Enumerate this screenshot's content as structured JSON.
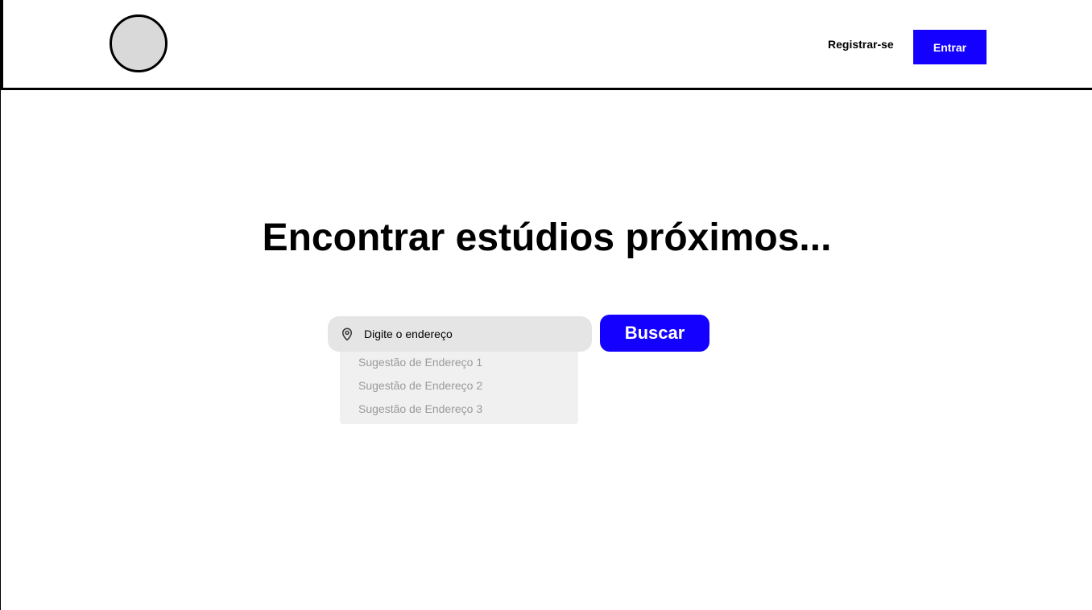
{
  "header": {
    "register_label": "Registrar-se",
    "login_label": "Entrar"
  },
  "main": {
    "title": "Encontrar estúdios próximos...",
    "search": {
      "placeholder": "Digite o endereço",
      "value": "",
      "icon": "map-pin-icon",
      "button_label": "Buscar"
    },
    "suggestions": [
      "Sugestão de Endereço 1",
      "Sugestão de Endereço 2",
      "Sugestão de Endereço 3"
    ]
  },
  "colors": {
    "accent": "#1400ff",
    "input_bg": "#e5e5e5",
    "suggestions_bg": "#f0f0f0",
    "logo_fill": "#d9d9d9"
  }
}
